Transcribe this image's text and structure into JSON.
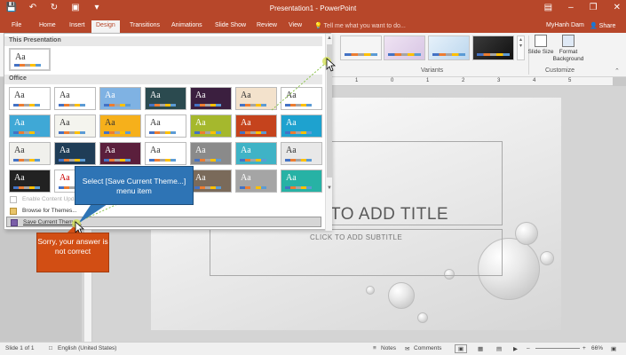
{
  "titlebar": {
    "title": "Presentation1 - PowerPoint",
    "qat": [
      "save-icon",
      "undo-icon",
      "redo-icon",
      "start-from-beginning-icon",
      "customize-icon"
    ],
    "window_buttons": [
      "ribbon-options",
      "minimize",
      "restore",
      "close"
    ]
  },
  "tabs": [
    "File",
    "Home",
    "Insert",
    "Design",
    "Transitions",
    "Animations",
    "Slide Show",
    "Review",
    "View"
  ],
  "active_tab": "Design",
  "tell_me": "Tell me what you want to do...",
  "user": "MyHanh Dam",
  "share": "Share",
  "ribbon": {
    "variants_label": "Variants",
    "slide_size": "Slide Size",
    "format_background": "Format Background",
    "customize_label": "Customize"
  },
  "themes": {
    "section_this": "This Presentation",
    "section_office": "Office",
    "aa": "Aa",
    "menu_enable": "Enable Content Updates from Office.com...",
    "menu_browse": "Browse for Themes...",
    "menu_save": "Save Current Theme..."
  },
  "slide": {
    "title_placeholder": "TO ADD TITLE",
    "subtitle_placeholder": "CLICK TO ADD SUBTITLE"
  },
  "callouts": {
    "instruction": "Select [Save Current Theme...] menu item",
    "error": "Sorry, your answer is not correct"
  },
  "status": {
    "slide": "Slide 1 of 1",
    "language": "English (United States)",
    "notes": "Notes",
    "comments": "Comments",
    "zoom": "66%"
  },
  "colors": {
    "accent": "#b7472a",
    "callout_blue": "#2e74b5",
    "callout_orange": "#d24e14"
  }
}
